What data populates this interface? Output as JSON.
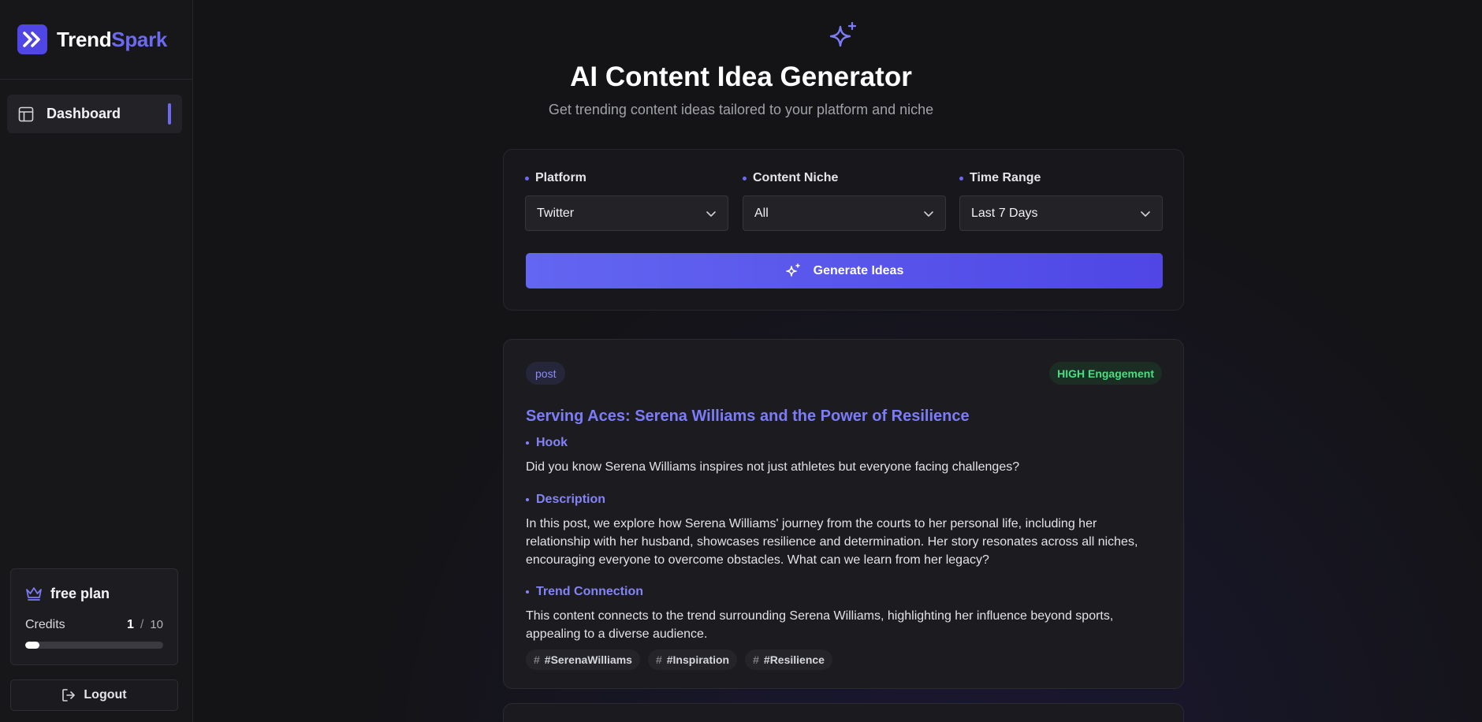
{
  "brand": {
    "name_part1": "Trend",
    "name_part2": "Spark"
  },
  "sidebar": {
    "items": [
      {
        "label": "Dashboard",
        "icon": "layout-icon",
        "active": true
      }
    ],
    "plan": {
      "name": "free plan",
      "credits_label": "Credits",
      "credits_used": "1",
      "credits_sep": "/",
      "credits_total": "10",
      "progress_fraction": 0.1
    },
    "logout_label": "Logout"
  },
  "header": {
    "icon": "sparkles-icon",
    "title": "AI Content Idea Generator",
    "subtitle": "Get trending content ideas tailored to your platform and niche"
  },
  "form": {
    "platform": {
      "label": "Platform",
      "value": "Twitter"
    },
    "niche": {
      "label": "Content Niche",
      "value": "All"
    },
    "time_range": {
      "label": "Time Range",
      "value": "Last 7 Days"
    },
    "generate_label": "Generate Ideas"
  },
  "ideas": [
    {
      "type": "post",
      "engagement": "HIGH Engagement",
      "title": "Serving Aces: Serena Williams and the Power of Resilience",
      "hook_label": "Hook",
      "hook": "Did you know Serena Williams inspires not just athletes but everyone facing challenges?",
      "description_label": "Description",
      "description": "In this post, we explore how Serena Williams' journey from the courts to her personal life, including her relationship with her husband, showcases resilience and determination. Her story resonates across all niches, encouraging everyone to overcome obstacles. What can we learn from her legacy?",
      "trend_label": "Trend Connection",
      "trend": "This content connects to the trend surrounding Serena Williams, highlighting her influence beyond sports, appealing to a diverse audience.",
      "tags": [
        "#SerenaWilliams",
        "#Inspiration",
        "#Resilience"
      ]
    }
  ],
  "colors": {
    "accent": "#6d6af2",
    "background": "#141417",
    "success": "#4ade80"
  }
}
